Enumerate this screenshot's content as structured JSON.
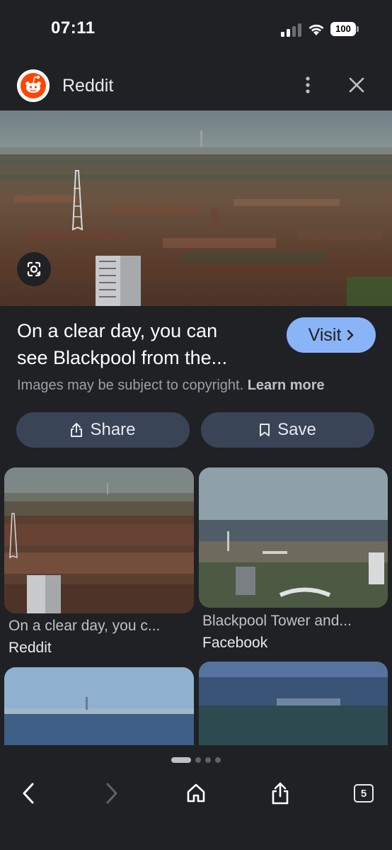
{
  "status_bar": {
    "time": "07:11",
    "battery": "100"
  },
  "source": {
    "name": "Reddit",
    "icon": "reddit-logo"
  },
  "result": {
    "title_line1": "On a clear day, you can",
    "title_line2": "see Blackpool from the...",
    "visit_label": "Visit",
    "copyright_text": "Images may be subject to copyright.",
    "learn_more": "Learn more",
    "share_label": "Share",
    "save_label": "Save"
  },
  "related": [
    {
      "caption": "On a clear day, you c...",
      "source": "Reddit"
    },
    {
      "caption": "Blackpool Tower and...",
      "source": "Facebook"
    },
    {
      "caption": "",
      "source": ""
    },
    {
      "caption": "",
      "source": ""
    }
  ],
  "nav": {
    "tab_count": "5"
  },
  "colors": {
    "background": "#202124",
    "accent": "#8ab4f8",
    "button": "#394457",
    "reddit": "#ff4500"
  }
}
